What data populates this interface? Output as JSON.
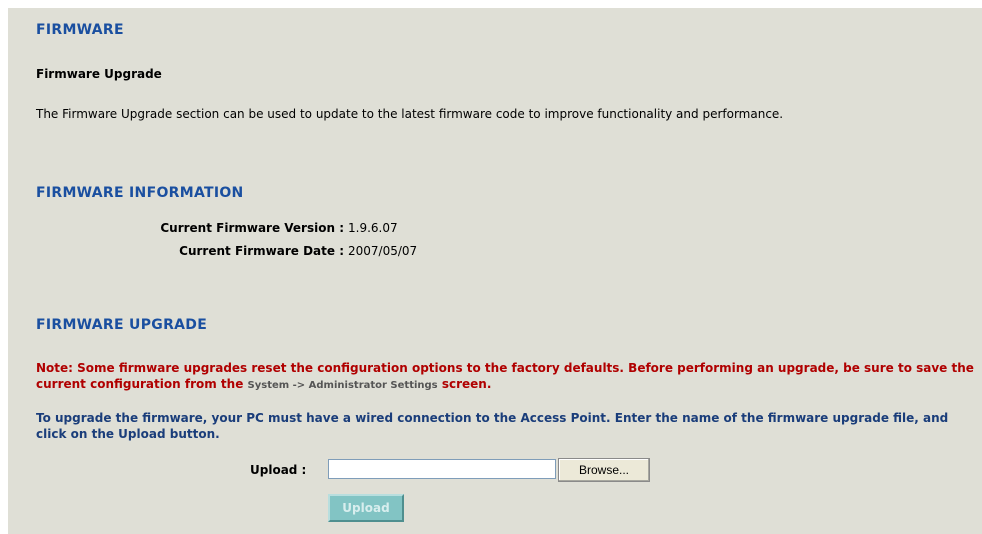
{
  "firmware": {
    "heading": "FIRMWARE",
    "subheading": "Firmware Upgrade",
    "description": "The Firmware Upgrade section can be used to update to the latest firmware code to improve functionality and performance."
  },
  "info": {
    "heading": "FIRMWARE INFORMATION",
    "version_label": "Current Firmware Version :",
    "version_value": "1.9.6.07",
    "date_label": "Current Firmware Date :",
    "date_value": "2007/05/07"
  },
  "upgrade": {
    "heading": "FIRMWARE UPGRADE",
    "note_prefix": "Note: Some firmware upgrades reset the configuration options to the factory defaults. Before performing an upgrade, be sure to save the current configuration from the ",
    "note_path": "System -> Administrator Settings",
    "note_suffix": " screen.",
    "instructions": "To upgrade the firmware, your PC must have a wired connection to the Access Point. Enter the name of the firmware upgrade file, and click on the Upload button.",
    "upload_label": "Upload :",
    "file_value": "",
    "browse_label": "Browse...",
    "upload_button_label": "Upload"
  }
}
